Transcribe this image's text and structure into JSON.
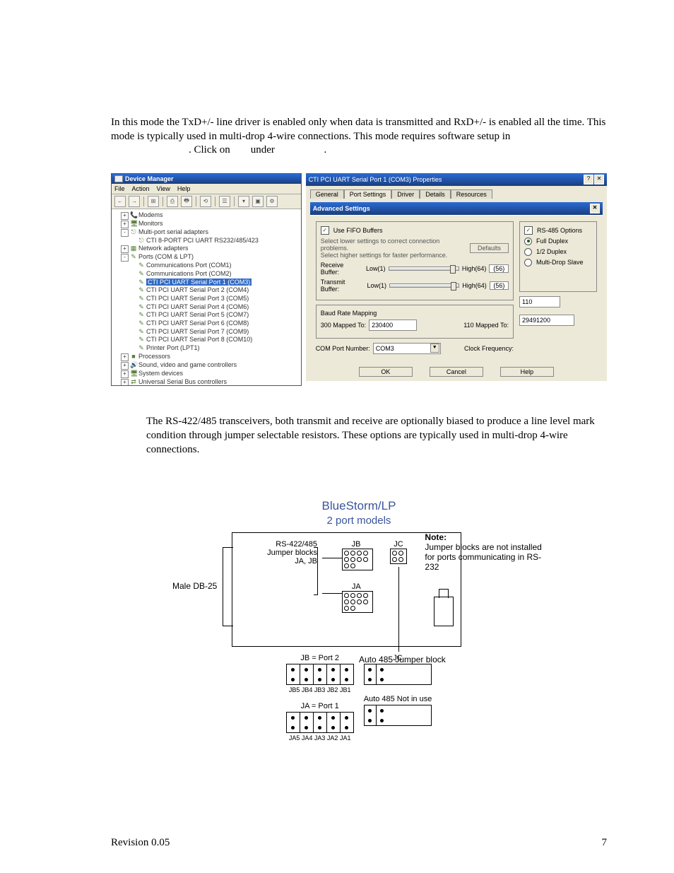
{
  "paragraph1": "In this mode the TxD+/- line driver is enabled only when data is transmitted and RxD+/- is enabled all the time. This mode is typically used in multi-drop 4-wire connections. This mode requires software setup in",
  "click_prefix": ". Click on",
  "click_mid": "under",
  "click_suffix": ".",
  "paragraph2": "The RS-422/485 transceivers, both transmit and receive are optionally biased to produce a line level mark condition through jumper selectable resistors. These options are typically used in multi-drop 4-wire connections.",
  "devmgr": {
    "title": "Device Manager",
    "menu": [
      "File",
      "Action",
      "View",
      "Help"
    ],
    "tree": [
      {
        "indent": 1,
        "exp": "+",
        "icon": "📞",
        "label": "Modems"
      },
      {
        "indent": 1,
        "exp": "+",
        "icon": "🖥",
        "label": "Monitors"
      },
      {
        "indent": 1,
        "exp": "-",
        "icon": "⎋",
        "label": "Multi-port serial adapters"
      },
      {
        "indent": 2,
        "exp": "",
        "icon": "⎋",
        "label": "CTI 8-PORT PCI UART RS232/485/423"
      },
      {
        "indent": 1,
        "exp": "+",
        "icon": "▦",
        "label": "Network adapters"
      },
      {
        "indent": 1,
        "exp": "-",
        "icon": "✎",
        "label": "Ports (COM & LPT)"
      },
      {
        "indent": 2,
        "exp": "",
        "icon": "✎",
        "label": "Communications Port (COM1)"
      },
      {
        "indent": 2,
        "exp": "",
        "icon": "✎",
        "label": "Communications Port (COM2)"
      },
      {
        "indent": 2,
        "exp": "",
        "icon": "✎",
        "label": "CTI PCI UART Serial Port 1 (COM3)",
        "selected": true
      },
      {
        "indent": 2,
        "exp": "",
        "icon": "✎",
        "label": "CTI PCI UART Serial Port 2 (COM4)"
      },
      {
        "indent": 2,
        "exp": "",
        "icon": "✎",
        "label": "CTI PCI UART Serial Port 3 (COM5)"
      },
      {
        "indent": 2,
        "exp": "",
        "icon": "✎",
        "label": "CTI PCI UART Serial Port 4 (COM6)"
      },
      {
        "indent": 2,
        "exp": "",
        "icon": "✎",
        "label": "CTI PCI UART Serial Port 5 (COM7)"
      },
      {
        "indent": 2,
        "exp": "",
        "icon": "✎",
        "label": "CTI PCI UART Serial Port 6 (COM8)"
      },
      {
        "indent": 2,
        "exp": "",
        "icon": "✎",
        "label": "CTI PCI UART Serial Port 7 (COM9)"
      },
      {
        "indent": 2,
        "exp": "",
        "icon": "✎",
        "label": "CTI PCI UART Serial Port 8 (COM10)"
      },
      {
        "indent": 2,
        "exp": "",
        "icon": "✎",
        "label": "Printer Port (LPT1)"
      },
      {
        "indent": 1,
        "exp": "+",
        "icon": "■",
        "label": "Processors"
      },
      {
        "indent": 1,
        "exp": "+",
        "icon": "🔊",
        "label": "Sound, video and game controllers"
      },
      {
        "indent": 1,
        "exp": "+",
        "icon": "🖥",
        "label": "System devices"
      },
      {
        "indent": 1,
        "exp": "+",
        "icon": "⇄",
        "label": "Universal Serial Bus controllers"
      }
    ]
  },
  "props": {
    "title": "CTI PCI UART Serial Port 1 (COM3) Properties",
    "tabs": [
      "General",
      "Port Settings",
      "Driver",
      "Details",
      "Resources"
    ],
    "advanced_title": "Advanced Settings",
    "use_fifo": "Use FIFO Buffers",
    "desc1": "Select lower settings to correct connection problems.",
    "desc2": "Select higher settings for faster performance.",
    "defaults_btn": "Defaults",
    "receive_label": "Receive Buffer:",
    "transmit_label": "Transmit Buffer:",
    "low_label": "Low(1)",
    "high_label": "High(64)",
    "rx_val": "(56)",
    "tx_val": "(56)",
    "baud_group": "Baud Rate Mapping",
    "map300": "300 Mapped To:",
    "map300_val": "230400",
    "map110": "110 Mapped To:",
    "map110_val": "110",
    "com_number": "COM Port Number:",
    "com_val": "COM3",
    "clock_freq": "Clock Frequency:",
    "clock_val": "29491200",
    "rs485_group": "RS-485 Options",
    "opt_full": "Full Duplex",
    "opt_half": "1/2 Duplex",
    "opt_slave": "Multi-Drop Slave",
    "ok": "OK",
    "cancel": "Cancel",
    "help": "Help"
  },
  "diagram": {
    "title": "BlueStorm/LP",
    "subtitle": "2 port models",
    "conn_label": "Male DB-25",
    "rs_label": "RS-422/485\nJumper blocks\nJA, JB",
    "jb": "JB",
    "jc": "JC",
    "ja": "JA",
    "note_head": "Note:",
    "note_body": "Jumper blocks are not installed for ports communicating in RS-232",
    "auto_label": "Auto 485 Jumper block",
    "jb_port2": "JB = Port 2",
    "ja_port1": "JA = Port 1",
    "jc_label": "JC",
    "auto_notinuse": "Auto 485 Not in use",
    "jb_names": "JB5 JB4 JB3 JB2 JB1",
    "ja_names": "JA5 JA4 JA3 JA2 JA1"
  },
  "footer_left": "Revision 0.05",
  "footer_right": "7"
}
